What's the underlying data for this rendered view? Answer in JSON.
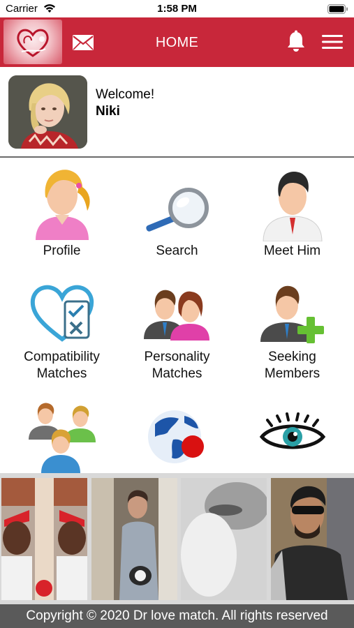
{
  "status_bar": {
    "carrier": "Carrier",
    "time": "1:58 PM"
  },
  "header": {
    "title": "HOME"
  },
  "welcome": {
    "greeting": "Welcome!",
    "name": "Niki"
  },
  "menu": {
    "items": [
      {
        "label": "Profile"
      },
      {
        "label": "Search"
      },
      {
        "label": "Meet Him"
      },
      {
        "label": "Compatibility Matches"
      },
      {
        "label": "Personality Matches"
      },
      {
        "label": "Seeking Members"
      },
      {
        "label": ""
      },
      {
        "label": ""
      },
      {
        "label": ""
      }
    ]
  },
  "footer": {
    "copyright": "Copyright © 2020 Dr love match. All rights reserved"
  },
  "colors": {
    "header": "#c8273a",
    "footer": "#5a5a5a",
    "photo_strip": "#d9d9d9"
  }
}
